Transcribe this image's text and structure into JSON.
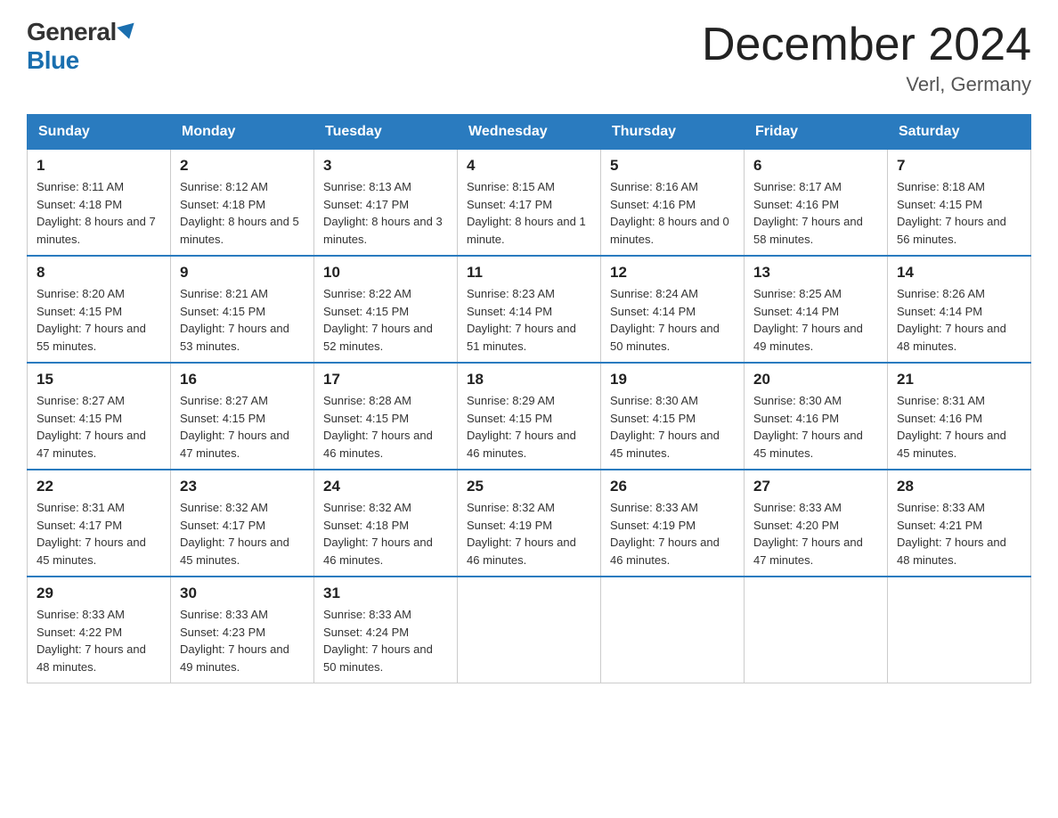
{
  "logo": {
    "general": "General",
    "blue": "Blue",
    "triangle_label": "logo-triangle"
  },
  "title": "December 2024",
  "subtitle": "Verl, Germany",
  "days_of_week": [
    "Sunday",
    "Monday",
    "Tuesday",
    "Wednesday",
    "Thursday",
    "Friday",
    "Saturday"
  ],
  "weeks": [
    [
      {
        "day": "1",
        "sunrise": "8:11 AM",
        "sunset": "4:18 PM",
        "daylight": "8 hours and 7 minutes."
      },
      {
        "day": "2",
        "sunrise": "8:12 AM",
        "sunset": "4:18 PM",
        "daylight": "8 hours and 5 minutes."
      },
      {
        "day": "3",
        "sunrise": "8:13 AM",
        "sunset": "4:17 PM",
        "daylight": "8 hours and 3 minutes."
      },
      {
        "day": "4",
        "sunrise": "8:15 AM",
        "sunset": "4:17 PM",
        "daylight": "8 hours and 1 minute."
      },
      {
        "day": "5",
        "sunrise": "8:16 AM",
        "sunset": "4:16 PM",
        "daylight": "8 hours and 0 minutes."
      },
      {
        "day": "6",
        "sunrise": "8:17 AM",
        "sunset": "4:16 PM",
        "daylight": "7 hours and 58 minutes."
      },
      {
        "day": "7",
        "sunrise": "8:18 AM",
        "sunset": "4:15 PM",
        "daylight": "7 hours and 56 minutes."
      }
    ],
    [
      {
        "day": "8",
        "sunrise": "8:20 AM",
        "sunset": "4:15 PM",
        "daylight": "7 hours and 55 minutes."
      },
      {
        "day": "9",
        "sunrise": "8:21 AM",
        "sunset": "4:15 PM",
        "daylight": "7 hours and 53 minutes."
      },
      {
        "day": "10",
        "sunrise": "8:22 AM",
        "sunset": "4:15 PM",
        "daylight": "7 hours and 52 minutes."
      },
      {
        "day": "11",
        "sunrise": "8:23 AM",
        "sunset": "4:14 PM",
        "daylight": "7 hours and 51 minutes."
      },
      {
        "day": "12",
        "sunrise": "8:24 AM",
        "sunset": "4:14 PM",
        "daylight": "7 hours and 50 minutes."
      },
      {
        "day": "13",
        "sunrise": "8:25 AM",
        "sunset": "4:14 PM",
        "daylight": "7 hours and 49 minutes."
      },
      {
        "day": "14",
        "sunrise": "8:26 AM",
        "sunset": "4:14 PM",
        "daylight": "7 hours and 48 minutes."
      }
    ],
    [
      {
        "day": "15",
        "sunrise": "8:27 AM",
        "sunset": "4:15 PM",
        "daylight": "7 hours and 47 minutes."
      },
      {
        "day": "16",
        "sunrise": "8:27 AM",
        "sunset": "4:15 PM",
        "daylight": "7 hours and 47 minutes."
      },
      {
        "day": "17",
        "sunrise": "8:28 AM",
        "sunset": "4:15 PM",
        "daylight": "7 hours and 46 minutes."
      },
      {
        "day": "18",
        "sunrise": "8:29 AM",
        "sunset": "4:15 PM",
        "daylight": "7 hours and 46 minutes."
      },
      {
        "day": "19",
        "sunrise": "8:30 AM",
        "sunset": "4:15 PM",
        "daylight": "7 hours and 45 minutes."
      },
      {
        "day": "20",
        "sunrise": "8:30 AM",
        "sunset": "4:16 PM",
        "daylight": "7 hours and 45 minutes."
      },
      {
        "day": "21",
        "sunrise": "8:31 AM",
        "sunset": "4:16 PM",
        "daylight": "7 hours and 45 minutes."
      }
    ],
    [
      {
        "day": "22",
        "sunrise": "8:31 AM",
        "sunset": "4:17 PM",
        "daylight": "7 hours and 45 minutes."
      },
      {
        "day": "23",
        "sunrise": "8:32 AM",
        "sunset": "4:17 PM",
        "daylight": "7 hours and 45 minutes."
      },
      {
        "day": "24",
        "sunrise": "8:32 AM",
        "sunset": "4:18 PM",
        "daylight": "7 hours and 46 minutes."
      },
      {
        "day": "25",
        "sunrise": "8:32 AM",
        "sunset": "4:19 PM",
        "daylight": "7 hours and 46 minutes."
      },
      {
        "day": "26",
        "sunrise": "8:33 AM",
        "sunset": "4:19 PM",
        "daylight": "7 hours and 46 minutes."
      },
      {
        "day": "27",
        "sunrise": "8:33 AM",
        "sunset": "4:20 PM",
        "daylight": "7 hours and 47 minutes."
      },
      {
        "day": "28",
        "sunrise": "8:33 AM",
        "sunset": "4:21 PM",
        "daylight": "7 hours and 48 minutes."
      }
    ],
    [
      {
        "day": "29",
        "sunrise": "8:33 AM",
        "sunset": "4:22 PM",
        "daylight": "7 hours and 48 minutes."
      },
      {
        "day": "30",
        "sunrise": "8:33 AM",
        "sunset": "4:23 PM",
        "daylight": "7 hours and 49 minutes."
      },
      {
        "day": "31",
        "sunrise": "8:33 AM",
        "sunset": "4:24 PM",
        "daylight": "7 hours and 50 minutes."
      },
      null,
      null,
      null,
      null
    ]
  ]
}
